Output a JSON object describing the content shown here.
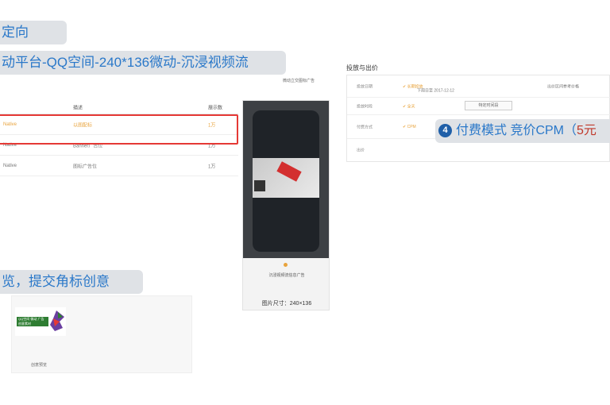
{
  "banners": {
    "b1": "定向",
    "b2": "动平台-QQ空间-240*136微动-沉浸视频流",
    "b3": "览，提交角标创意"
  },
  "top_note": "微动立交图标广告",
  "table": {
    "headers": [
      "",
      "描述",
      "展示数"
    ],
    "rows": [
      {
        "c1": "Native",
        "c2": "以图配标",
        "c3": "1万",
        "selected": true
      },
      {
        "c1": "Native",
        "c2": "Banner广告位",
        "c3": "1万",
        "selected": false
      },
      {
        "c1": "Native",
        "c2": "图标广告位",
        "c3": "1万",
        "selected": false
      }
    ]
  },
  "phone": {
    "title": "沉浸视频流信息广告",
    "size": "图片尺寸：240×136"
  },
  "creative": {
    "logo_text": "QQ空间 微动 广告 创意素材",
    "footnote": "创意预览"
  },
  "right_panel": {
    "title": "投放与出价",
    "rows": [
      {
        "label": "投放日期",
        "value": "✔ 长期投放",
        "extra": "下周日至 2017-12-12"
      },
      {
        "label": "投放时段",
        "value": "✔ 全天",
        "extra": "特定时间段"
      },
      {
        "label": "付费方式",
        "value": "✔ CPM",
        "extra": ""
      },
      {
        "label": "出价",
        "value": "",
        "extra": ""
      }
    ],
    "right_note": "出价区间参考价格"
  },
  "callout": {
    "num": "4",
    "text": "付费模式 竞价CPM（",
    "price": "5元"
  },
  "colors": {
    "banner_bg": "#dfe2e6",
    "banner_text": "#2a78c9",
    "highlight": "#e53935",
    "accent": "#e8a33c",
    "badge": "#1f5fa8"
  }
}
